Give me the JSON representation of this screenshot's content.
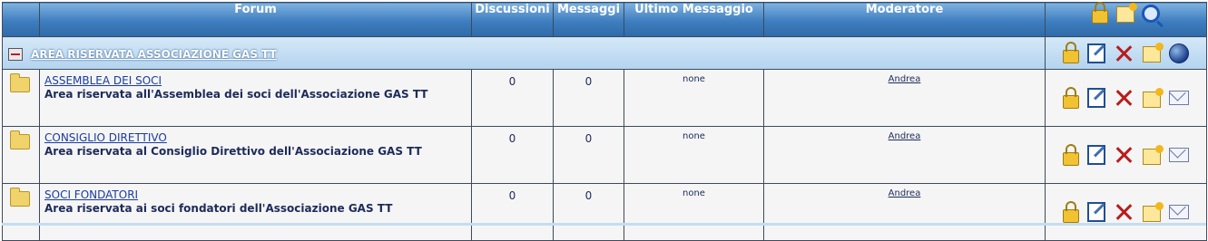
{
  "header": {
    "forum": "Forum",
    "topics": "Discussioni",
    "posts": "Messaggi",
    "last_post": "Ultimo Messaggio",
    "moderator": "Moderatore"
  },
  "header_icons": [
    "lock-icon",
    "new-post-icon",
    "search-icon"
  ],
  "category": {
    "name": "AREA RISERVATA ASSOCIAZIONE GAS TT",
    "icons": [
      "lock-icon",
      "edit-icon",
      "delete-icon",
      "new-post-icon",
      "globe-icon"
    ]
  },
  "forums": [
    {
      "title": "ASSEMBLEA DEI SOCI",
      "description": "Area riservata all'Assemblea dei soci dell'Associazione GAS TT",
      "topics": "0",
      "posts": "0",
      "last_post": "none",
      "moderator": "Andrea"
    },
    {
      "title": "CONSIGLIO DIRETTIVO",
      "description": "Area riservata al Consiglio Direttivo dell'Associazione GAS TT",
      "topics": "0",
      "posts": "0",
      "last_post": "none",
      "moderator": "Andrea"
    },
    {
      "title": "SOCI FONDATORI",
      "description": "Area riservata ai soci fondatori dell'Associazione GAS TT",
      "topics": "0",
      "posts": "0",
      "last_post": "none",
      "moderator": "Andrea"
    }
  ],
  "row_icons": [
    "lock-icon",
    "edit-icon",
    "delete-icon",
    "new-post-icon",
    "mail-icon"
  ],
  "colors": {
    "header_blue": "#3e7dbf",
    "category_blue": "#b3d3ef",
    "row_bg": "#f5f5f5",
    "delete_red": "#b81c1c"
  }
}
